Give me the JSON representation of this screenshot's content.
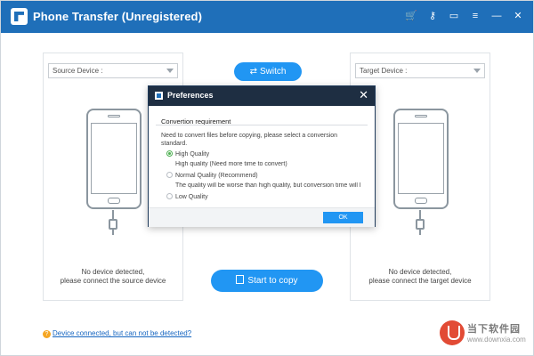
{
  "window": {
    "title": "Phone Transfer (Unregistered)"
  },
  "titlebar_icons": [
    "cart-icon",
    "key-icon",
    "feedback-icon",
    "menu-icon",
    "minimize-icon",
    "close-icon"
  ],
  "source": {
    "select_label": "Source Device :",
    "message_line1": "No device detected,",
    "message_line2": "please connect the source device"
  },
  "target": {
    "select_label": "Target Device :",
    "message_line1": "No device detected,",
    "message_line2": "please connect the target device"
  },
  "switch_label": "Switch",
  "start_label": "Start to copy",
  "help_link": "Device connected, but can not be detected?",
  "dialog": {
    "title": "Preferences",
    "section_title": "Convertion requirement",
    "description": "Need to convert files before copying, please select a conversion standard.",
    "options": [
      {
        "label": "High Quality",
        "checked": true,
        "note": "High quality (Need more time to convert)"
      },
      {
        "label": "Normal Quality (Recommend)",
        "checked": false,
        "note": "The quality will be worse than high quality, but conversion time will l"
      },
      {
        "label": "Low Quality",
        "checked": false,
        "note": ""
      }
    ],
    "ok_label": "OK"
  },
  "watermark": {
    "line1": "当下软件园",
    "line2": "www.downxia.com"
  },
  "colors": {
    "titlebar": "#1f6fb9",
    "accent": "#2196f3",
    "dialog_header": "#1e2e42",
    "radio_checked": "#4caf50"
  }
}
